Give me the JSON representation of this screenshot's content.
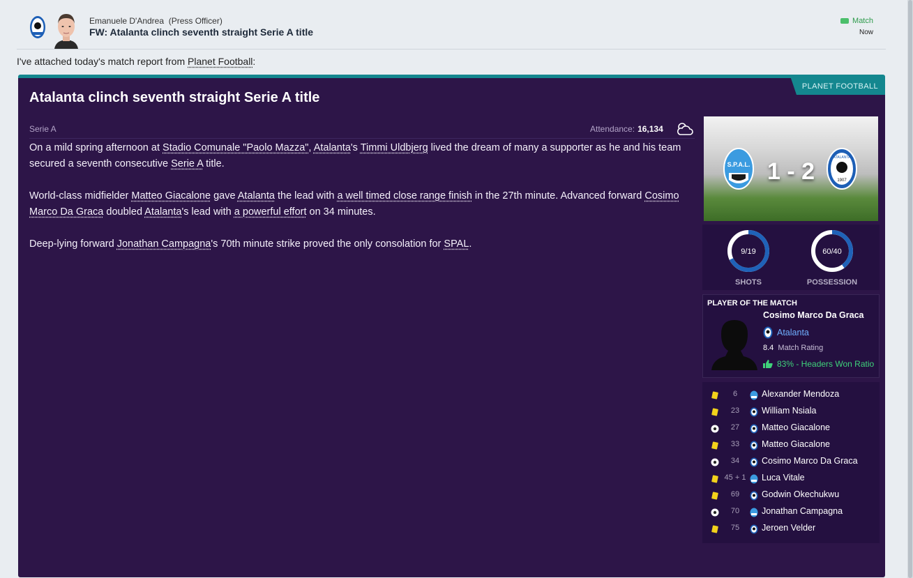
{
  "header": {
    "sender_name": "Emanuele D'Andrea",
    "sender_role": "(Press Officer)",
    "subject": "FW: Atalanta clinch seventh straight Serie A title",
    "tag": "Match",
    "time": "Now"
  },
  "intro": {
    "prefix": "I've attached today's match report from ",
    "source_link": "Planet Football",
    "suffix": ":"
  },
  "report": {
    "source": "PLANET FOOTBALL",
    "headline": "Atalanta clinch seventh straight Serie A title",
    "competition": "Serie A",
    "attendance_label": "Attendance:",
    "attendance_value": "16,134",
    "weather_icon": "cloud-icon",
    "p1": {
      "a": "On a mild spring afternoon at ",
      "stadium": "Stadio Comunale \"Paolo Mazza\"",
      "b": ", ",
      "team1": "Atalanta",
      "c": "'s ",
      "player1": "Timmi Uldbjerg",
      "d": " lived the dream of many a supporter as he and his team secured a seventh consecutive ",
      "league": "Serie A",
      "e": " title."
    },
    "p2": {
      "a": "World-class midfielder ",
      "player1": "Matteo Giacalone",
      "b": " gave ",
      "team1": "Atalanta",
      "c": " the lead with ",
      "goal1": "a well timed close range finish",
      "d": " in the 27th minute. Advanced forward ",
      "player2": "Cosimo Marco Da Graca",
      "e": " doubled ",
      "team2": "Atalanta",
      "f": "'s lead with ",
      "goal2": "a powerful effort",
      "g": " on 34 minutes."
    },
    "p3": {
      "a": "Deep-lying forward ",
      "player": "Jonathan Campagna",
      "b": "'s 70th minute strike proved the only consolation for ",
      "team": "SPAL",
      "c": "."
    }
  },
  "scoreboard": {
    "home_badge_text": "S.P.A.L.",
    "away_badge_text": "ATALANTA",
    "away_badge_year": "1907",
    "score": "1 - 2"
  },
  "stats": {
    "shots": {
      "text": "9/19",
      "label": "SHOTS",
      "home": 9,
      "away": 19
    },
    "possession": {
      "text": "60/40",
      "label": "POSSESSION",
      "home": 60,
      "away": 40
    }
  },
  "potm": {
    "title": "PLAYER OF THE MATCH",
    "name": "Cosimo Marco Da Graca",
    "team": "Atalanta",
    "rating": "8.4",
    "rating_label": "Match Rating",
    "stat": "83% - Headers Won Ratio"
  },
  "events": [
    {
      "type": "yellow-card",
      "minute": "6",
      "team": "spal",
      "player": "Alexander Mendoza"
    },
    {
      "type": "yellow-card",
      "minute": "23",
      "team": "atalanta",
      "player": "William Nsiala"
    },
    {
      "type": "goal",
      "minute": "27",
      "team": "atalanta",
      "player": "Matteo Giacalone"
    },
    {
      "type": "yellow-card",
      "minute": "33",
      "team": "atalanta",
      "player": "Matteo Giacalone"
    },
    {
      "type": "goal",
      "minute": "34",
      "team": "atalanta",
      "player": "Cosimo Marco Da Graca"
    },
    {
      "type": "yellow-card",
      "minute": "45 + 1",
      "team": "spal",
      "player": "Luca Vitale"
    },
    {
      "type": "yellow-card",
      "minute": "69",
      "team": "atalanta",
      "player": "Godwin Okechukwu"
    },
    {
      "type": "goal",
      "minute": "70",
      "team": "spal",
      "player": "Jonathan Campagna"
    },
    {
      "type": "yellow-card",
      "minute": "75",
      "team": "atalanta",
      "player": "Jeroen Velder"
    }
  ],
  "colors": {
    "report_bg": "#2d1548",
    "accent": "#14878f",
    "panel": "#241040",
    "link_blue": "#6fb0ff",
    "positive": "#3fd27a",
    "home_ring": "#ffffff",
    "away_ring": "#1f62b8"
  }
}
